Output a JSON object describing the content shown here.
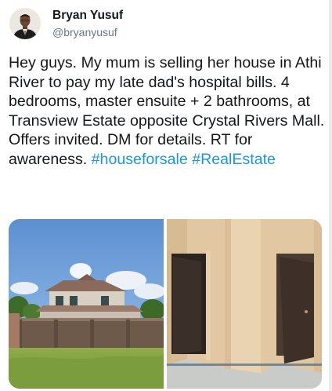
{
  "author": {
    "display_name": "Bryan Yusuf",
    "handle": "@bryanyusuf"
  },
  "tweet": {
    "text_segments": [
      "Hey guys. My mum is selling her house in Athi River to pay my late dad's hospital bills. 4 bedrooms, master ensuite + 2 bathrooms, at Transview Estate opposite Crystal Rivers Mall. Offers invited. DM for details. RT for awareness. "
    ],
    "hashtags": [
      "#houseforsale",
      "#RealEstate"
    ]
  },
  "media": {
    "photo_count": 2
  },
  "colors": {
    "text": "#14171a",
    "secondary_text": "#657786",
    "hashtag": "#1b95e0"
  }
}
